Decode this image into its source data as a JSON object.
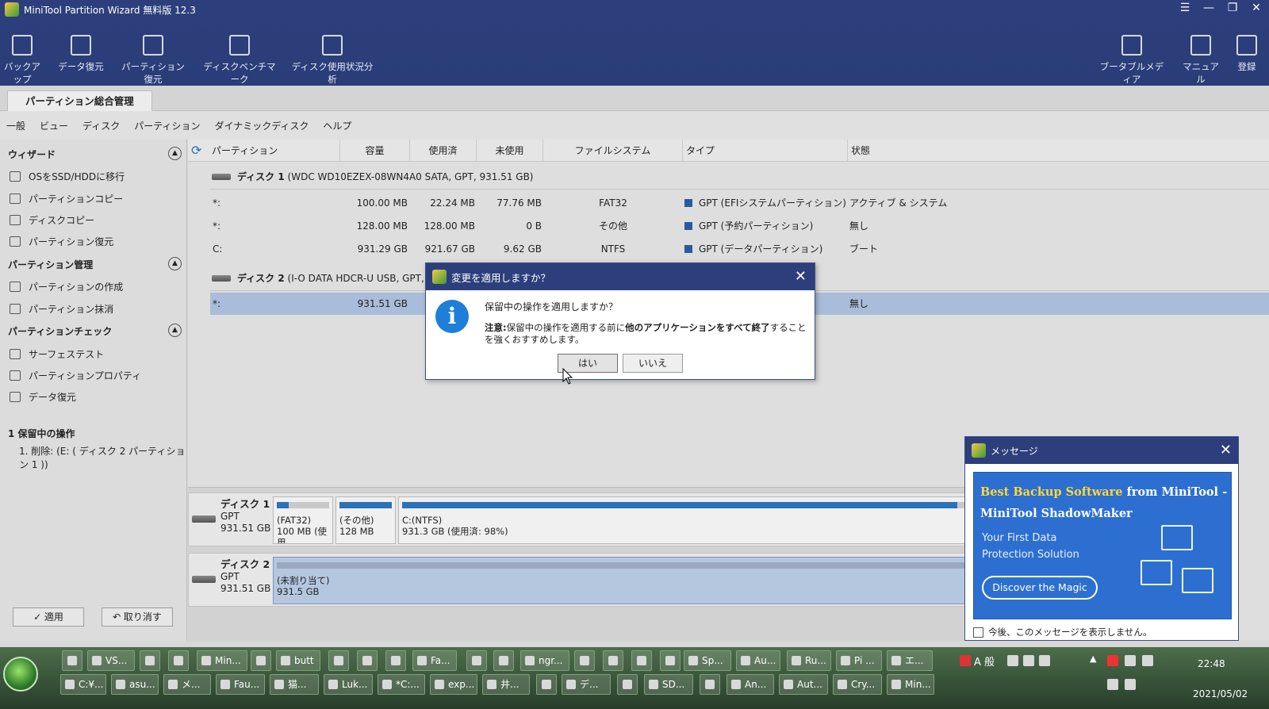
{
  "window": {
    "title": "MiniTool Partition Wizard 無料版 12.3",
    "controls": [
      "☰",
      "—",
      "❐",
      "✕"
    ]
  },
  "toolbar": {
    "left": [
      {
        "label": "バックアップ",
        "icon": "backup-icon"
      },
      {
        "label": "データ復元",
        "icon": "data-recovery-icon"
      },
      {
        "label": "パーティション復元",
        "icon": "partition-recovery-icon"
      },
      {
        "label": "ディスクベンチマーク",
        "icon": "disk-benchmark-icon"
      },
      {
        "label": "ディスク使用状況分析",
        "icon": "space-analyzer-icon"
      }
    ],
    "right": [
      {
        "label": "ブータブルメディア",
        "icon": "bootable-media-icon"
      },
      {
        "label": "マニュアル",
        "icon": "manual-icon"
      },
      {
        "label": "登録",
        "icon": "register-icon"
      }
    ]
  },
  "tab": "パーティション総合管理",
  "menu": [
    "一般",
    "ビュー",
    "ディスク",
    "パーティション",
    "ダイナミックディスク",
    "ヘルプ"
  ],
  "sidebar": {
    "wizard": {
      "title": "ウィザード",
      "items": [
        "OSをSSD/HDDに移行",
        "パーティションコピー",
        "ディスクコピー",
        "パーティション復元"
      ]
    },
    "manage": {
      "title": "パーティション管理",
      "items": [
        "パーティションの作成",
        "パーティション抹消"
      ]
    },
    "check": {
      "title": "パーティションチェック",
      "items": [
        "サーフェステスト",
        "パーティションプロパティ",
        "データ復元"
      ]
    },
    "pending_title": "1 保留中の操作",
    "pending_item": "1. 削除: (E: ( ディスク 2 パーティション 1 ))",
    "apply": "✓ 適用",
    "undo": "↶ 取り消す"
  },
  "table": {
    "headers": [
      "パーティション",
      "容量",
      "使用済",
      "未使用",
      "ファイルシステム",
      "タイプ",
      "状態"
    ],
    "disk1": {
      "name": "ディスク 1",
      "detail": "(WDC WD10EZEX-08WN4A0 SATA, GPT, 931.51 GB)"
    },
    "rows1": [
      [
        "*:",
        "100.00 MB",
        "22.24 MB",
        "77.76 MB",
        "FAT32",
        "GPT (EFIシステムパーティション)",
        "アクティブ & システム"
      ],
      [
        "*:",
        "128.00 MB",
        "128.00 MB",
        "0 B",
        "その他",
        "GPT (予約パーティション)",
        "無し"
      ],
      [
        "C:",
        "931.29 GB",
        "921.67 GB",
        "9.62 GB",
        "NTFS",
        "GPT (データパーティション)",
        "ブート"
      ]
    ],
    "disk2": {
      "name": "ディスク 2",
      "detail": "(I-O DATA HDCR-U USB, GPT, 931.51"
    },
    "rows2": [
      [
        "*:",
        "931.51 GB",
        "無し"
      ]
    ]
  },
  "diskmap": {
    "disk1": {
      "name": "ディスク 1",
      "type": "GPT",
      "size": "931.51 GB",
      "parts": [
        {
          "l1": "(FAT32)",
          "l2": "100 MB (使用",
          "used": 0.22
        },
        {
          "l1": "(その他)",
          "l2": "128 MB",
          "used": 1.0
        },
        {
          "l1": "C:(NTFS)",
          "l2": "931.3 GB (使用済: 98%)",
          "used": 0.98
        }
      ]
    },
    "disk2": {
      "name": "ディスク 2",
      "type": "GPT",
      "size": "931.51 GB",
      "parts": [
        {
          "l1": "(未割り当て)",
          "l2": "931.5 GB"
        }
      ]
    }
  },
  "dialog": {
    "title": "変更を適用しますか？",
    "question": "保留中の操作を適用しますか？",
    "note_bold1": "注意:",
    "note_mid": "保留中の操作を適用する前に",
    "note_bold2": "他のアプリケーションをすべて終了",
    "note_end": "することを強くおすすめします。",
    "yes": "はい",
    "no": "いいえ"
  },
  "ad": {
    "title": "メッセージ",
    "h1_highlight": "Best Backup Software",
    "h1_rest": " from MiniTool -",
    "h2": "MiniTool ShadowMaker",
    "sub1": "Your First Data",
    "sub2": "Protection Solution",
    "cta": "Discover the Magic",
    "checkbox": "今後、このメッセージを表示しません。"
  },
  "taskbar": {
    "row1": [
      "VS...",
      "Min...",
      "butt",
      "Fa...",
      "ngr...",
      "Sp...",
      "Au...",
      "Ru...",
      "Pi ...",
      "エ..."
    ],
    "row2": [
      "C:¥...",
      "asu...",
      "メ...",
      "Fau...",
      "猫...",
      "Luk...",
      "*C:...",
      "exp...",
      "井...",
      "デ...",
      "SD...",
      "An...",
      "Aut...",
      "Cry...",
      "Min..."
    ],
    "ime": "A 般",
    "clock": "22:48",
    "date": "2021/05/02"
  }
}
